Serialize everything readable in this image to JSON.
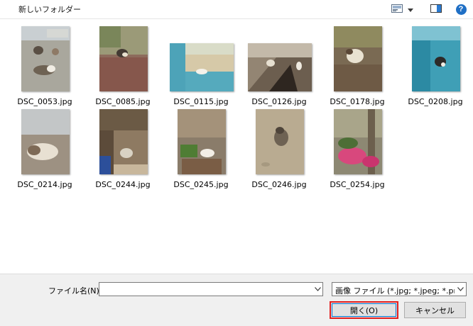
{
  "topbar": {
    "folder_title": "新しいフォルダー",
    "icons": [
      "view-options-icon",
      "chevron-down-icon",
      "preview-pane-icon",
      "help-icon"
    ],
    "help_glyph": "?"
  },
  "files": [
    {
      "name": "DSC_0053.jpg"
    },
    {
      "name": "DSC_0085.jpg"
    },
    {
      "name": "DSC_0115.jpg"
    },
    {
      "name": "DSC_0126.jpg"
    },
    {
      "name": "DSC_0178.jpg"
    },
    {
      "name": "DSC_0208.jpg"
    },
    {
      "name": "DSC_0214.jpg"
    },
    {
      "name": "DSC_0244.jpg"
    },
    {
      "name": "DSC_0245.jpg"
    },
    {
      "name": "DSC_0246.jpg"
    },
    {
      "name": "DSC_0254.jpg"
    }
  ],
  "footer": {
    "filename_label": "ファイル名(N):",
    "filename_value": "",
    "filter_selected": "画像 ファイル (*.jpg; *.jpeg; *.png",
    "open_label": "開く(O)",
    "cancel_label": "キャンセル"
  },
  "colors": {
    "highlight": "#e21f1f",
    "accent": "#0078d7",
    "help": "#1f6fc5"
  }
}
